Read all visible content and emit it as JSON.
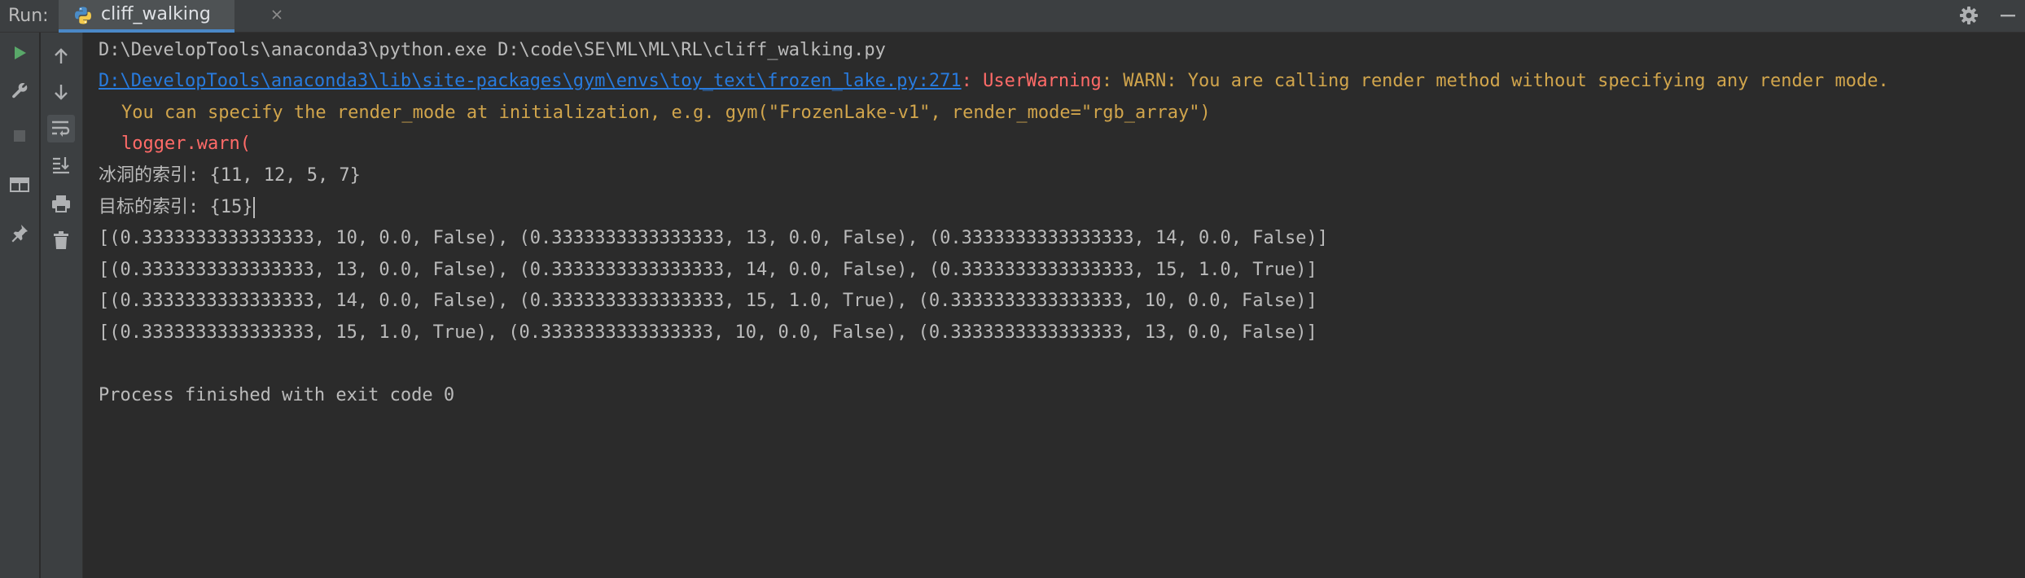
{
  "topbar": {
    "run_label": "Run:",
    "tab_name": "cliff_walking"
  },
  "left_toolbar": {
    "col1": [
      "run-icon",
      "wrench-icon",
      "stop-icon",
      "layout-icon",
      "pin-icon"
    ],
    "col2": [
      "up-arrow-icon",
      "down-arrow-icon",
      "soft-wrap-icon",
      "scroll-to-end-icon",
      "print-icon",
      "trash-icon"
    ]
  },
  "console": {
    "command": "D:\\DevelopTools\\anaconda3\\python.exe D:\\code\\SE\\ML\\ML\\RL\\cliff_walking.py",
    "warning_link": "D:\\DevelopTools\\anaconda3\\lib\\site-packages\\gym\\envs\\toy_text\\frozen_lake.py:271",
    "warning_sep": ": ",
    "warning_type": "UserWarning",
    "warning_msg": ": WARN: You are calling render method without specifying any render mode.",
    "warning_line2": "You can specify the render_mode at initialization, e.g. gym(\"FrozenLake-v1\", render_mode=\"rgb_array\")",
    "warning_line3": "logger.warn(",
    "holes_line": "冰洞的索引: {11, 12, 5, 7}",
    "goal_line": "目标的索引: {15}",
    "transitions": [
      "[(0.3333333333333333, 10, 0.0, False), (0.3333333333333333, 13, 0.0, False), (0.3333333333333333, 14, 0.0, False)]",
      "[(0.3333333333333333, 13, 0.0, False), (0.3333333333333333, 14, 0.0, False), (0.3333333333333333, 15, 1.0, True)]",
      "[(0.3333333333333333, 14, 0.0, False), (0.3333333333333333, 15, 1.0, True), (0.3333333333333333, 10, 0.0, False)]",
      "[(0.3333333333333333, 15, 1.0, True), (0.3333333333333333, 10, 0.0, False), (0.3333333333333333, 13, 0.0, False)]"
    ],
    "exit_line": "Process finished with exit code 0"
  },
  "colors": {
    "background": "#2b2b2b",
    "toolbar": "#3c3f41",
    "text": "#bbbbbb",
    "link": "#287bde",
    "error": "#ff6b68",
    "warning": "#d1a54c",
    "run_green": "#59a869",
    "tab_underline": "#4a88c7"
  }
}
